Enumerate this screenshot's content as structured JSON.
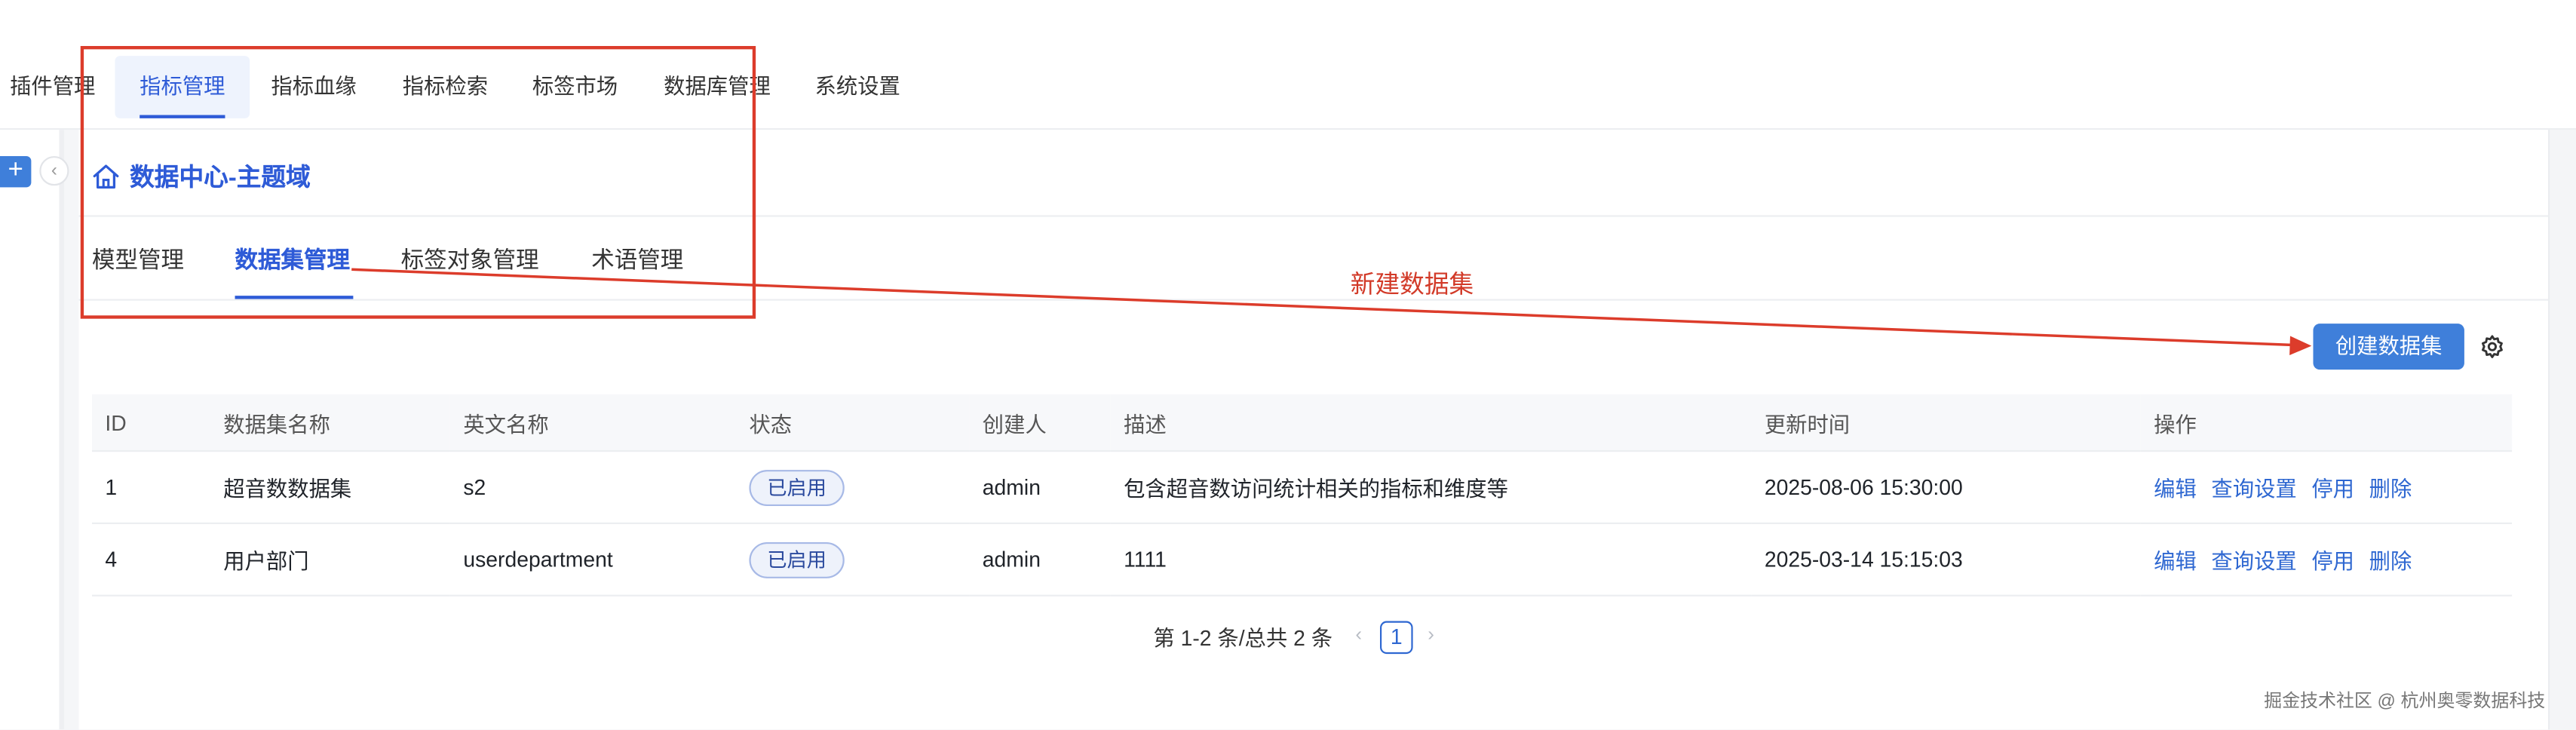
{
  "top_nav": {
    "items": [
      {
        "label": "插件管理",
        "active": false
      },
      {
        "label": "指标管理",
        "active": true
      },
      {
        "label": "指标血缘",
        "active": false
      },
      {
        "label": "指标检索",
        "active": false
      },
      {
        "label": "标签市场",
        "active": false
      },
      {
        "label": "数据库管理",
        "active": false
      },
      {
        "label": "系统设置",
        "active": false
      }
    ]
  },
  "sidebar": {
    "add_symbol": "+",
    "collapse_symbol": "‹"
  },
  "page": {
    "title": "数据中心-主题域",
    "home_icon": "home-icon"
  },
  "sub_tabs": [
    {
      "label": "模型管理",
      "active": false
    },
    {
      "label": "数据集管理",
      "active": true
    },
    {
      "label": "标签对象管理",
      "active": false
    },
    {
      "label": "术语管理",
      "active": false
    }
  ],
  "annotation": {
    "text": "新建数据集",
    "color": "#d23a28"
  },
  "toolbar": {
    "create_label": "创建数据集",
    "settings_icon": "gear-icon"
  },
  "table": {
    "columns": [
      "ID",
      "数据集名称",
      "英文名称",
      "状态",
      "创建人",
      "描述",
      "更新时间",
      "操作"
    ],
    "rows": [
      {
        "id": "1",
        "name": "超音数数据集",
        "en_name": "s2",
        "status": "已启用",
        "creator": "admin",
        "desc": "包含超音数访问统计相关的指标和维度等",
        "updated": "2025-08-06 15:30:00",
        "ops": [
          "编辑",
          "查询设置",
          "停用",
          "删除"
        ]
      },
      {
        "id": "4",
        "name": "用户部门",
        "en_name": "userdepartment",
        "status": "已启用",
        "creator": "admin",
        "desc": "1111",
        "updated": "2025-03-14 15:15:03",
        "ops": [
          "编辑",
          "查询设置",
          "停用",
          "删除"
        ]
      }
    ]
  },
  "pagination": {
    "summary": "第 1-2 条/总共 2 条",
    "current_page": "1",
    "prev": "‹",
    "next": "›"
  },
  "watermark": "掘金技术社区 @ 杭州奥零数据科技",
  "colors": {
    "primary": "#3f7fda",
    "active_text": "#2e5bd7",
    "annotation_red": "#dc3c2b"
  }
}
